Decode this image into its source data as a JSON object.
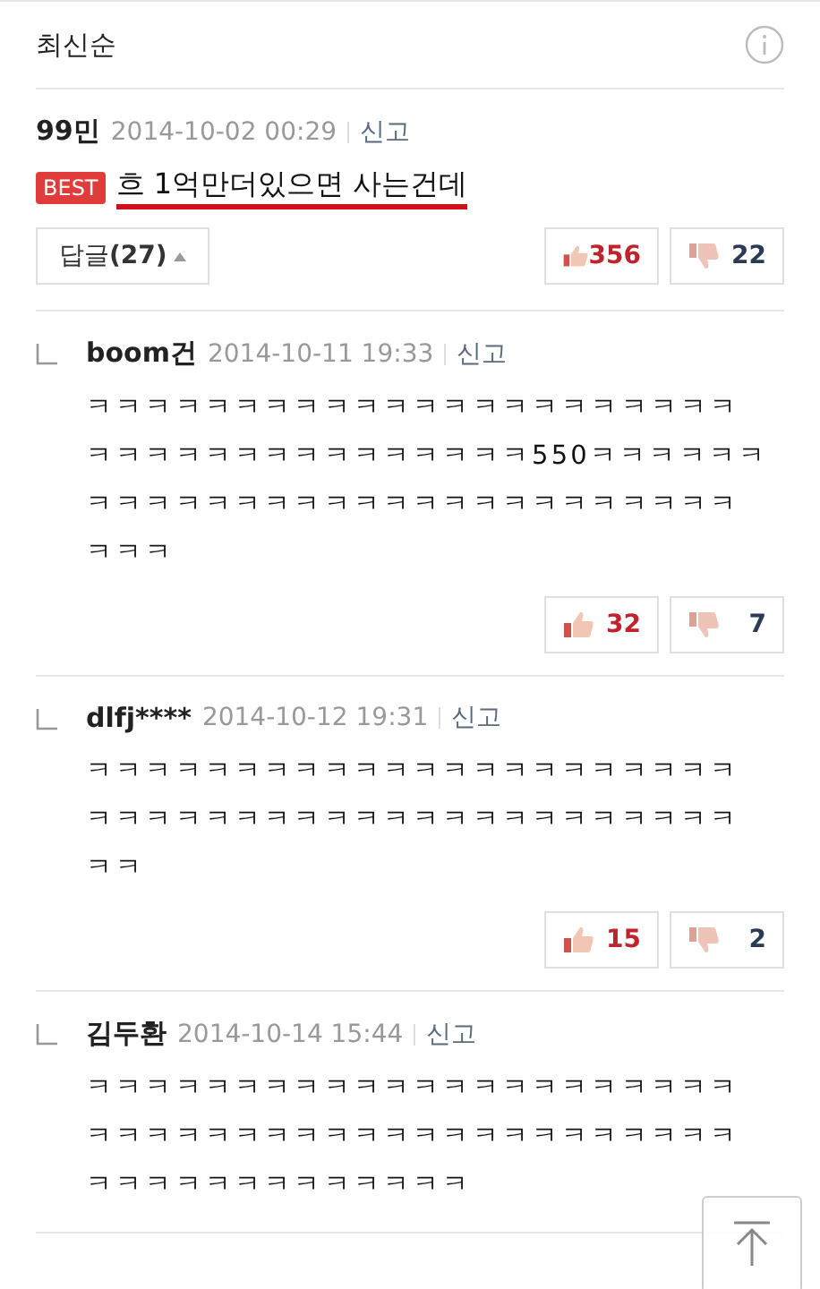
{
  "header": {
    "sort_label": "최신순"
  },
  "best_comment": {
    "author": "99민",
    "date": "2014-10-02 00:29",
    "report": "신고",
    "badge": "BEST",
    "text": "흐 1억만더있으면 사는건데",
    "reply_button": {
      "label": "답글",
      "count": "(27)",
      "expanded": true
    },
    "likes": "356",
    "dislikes": "22"
  },
  "replies": [
    {
      "author": "boom건",
      "date": "2014-10-11 19:33",
      "report": "신고",
      "lines": [
        "ㅋㅋㅋㅋㅋㅋㅋㅋㅋㅋㅋㅋㅋㅋㅋㅋㅋㅋㅋㅋㅋㅋ",
        "ㅋㅋㅋㅋㅋㅋㅋㅋㅋㅋㅋㅋㅋㅋㅋ550ㅋㅋㅋㅋㅋㅋ",
        "ㅋㅋㅋㅋㅋㅋㅋㅋㅋㅋㅋㅋㅋㅋㅋㅋㅋㅋㅋㅋㅋㅋ",
        "ㅋㅋㅋ"
      ],
      "likes": "32",
      "dislikes": "7"
    },
    {
      "author": "dlfj****",
      "date": "2014-10-12 19:31",
      "report": "신고",
      "lines": [
        "ㅋㅋㅋㅋㅋㅋㅋㅋㅋㅋㅋㅋㅋㅋㅋㅋㅋㅋㅋㅋㅋㅋ",
        "ㅋㅋㅋㅋㅋㅋㅋㅋㅋㅋㅋㅋㅋㅋㅋㅋㅋㅋㅋㅋㅋㅋ",
        "ㅋㅋ"
      ],
      "likes": "15",
      "dislikes": "2"
    },
    {
      "author": "김두환",
      "date": "2014-10-14 15:44",
      "report": "신고",
      "lines": [
        "ㅋㅋㅋㅋㅋㅋㅋㅋㅋㅋㅋㅋㅋㅋㅋㅋㅋㅋㅋㅋㅋㅋ",
        "ㅋㅋㅋㅋㅋㅋㅋㅋㅋㅋㅋㅋㅋㅋㅋㅋㅋㅋㅋㅋㅋㅋ",
        "ㅋㅋㅋㅋㅋㅋㅋㅋㅋㅋㅋㅋㅋ"
      ]
    }
  ]
}
